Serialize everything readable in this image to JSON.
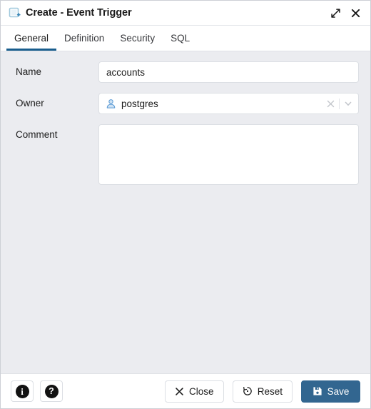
{
  "window": {
    "title": "Create - Event Trigger",
    "icon": "event-trigger-icon",
    "expand_label": "Maximize",
    "close_label": "Close"
  },
  "tabs": [
    {
      "label": "General",
      "active": true
    },
    {
      "label": "Definition",
      "active": false
    },
    {
      "label": "Security",
      "active": false
    },
    {
      "label": "SQL",
      "active": false
    }
  ],
  "form": {
    "name": {
      "label": "Name",
      "value": "accounts",
      "placeholder": ""
    },
    "owner": {
      "label": "Owner",
      "value": "postgres",
      "icon": "user-icon",
      "clear_label": "Clear",
      "dropdown_label": "Open"
    },
    "comment": {
      "label": "Comment",
      "value": "",
      "placeholder": ""
    }
  },
  "footer": {
    "info_label": "i",
    "help_label": "?",
    "close_label": "Close",
    "reset_label": "Reset",
    "save_label": "Save"
  },
  "colors": {
    "accent": "#326690",
    "tab_underline": "#195d8d",
    "body_bg": "#ebecf0",
    "panel_bg": "#ffffff",
    "border": "#dcdfe4",
    "text": "#1b1b1b"
  }
}
